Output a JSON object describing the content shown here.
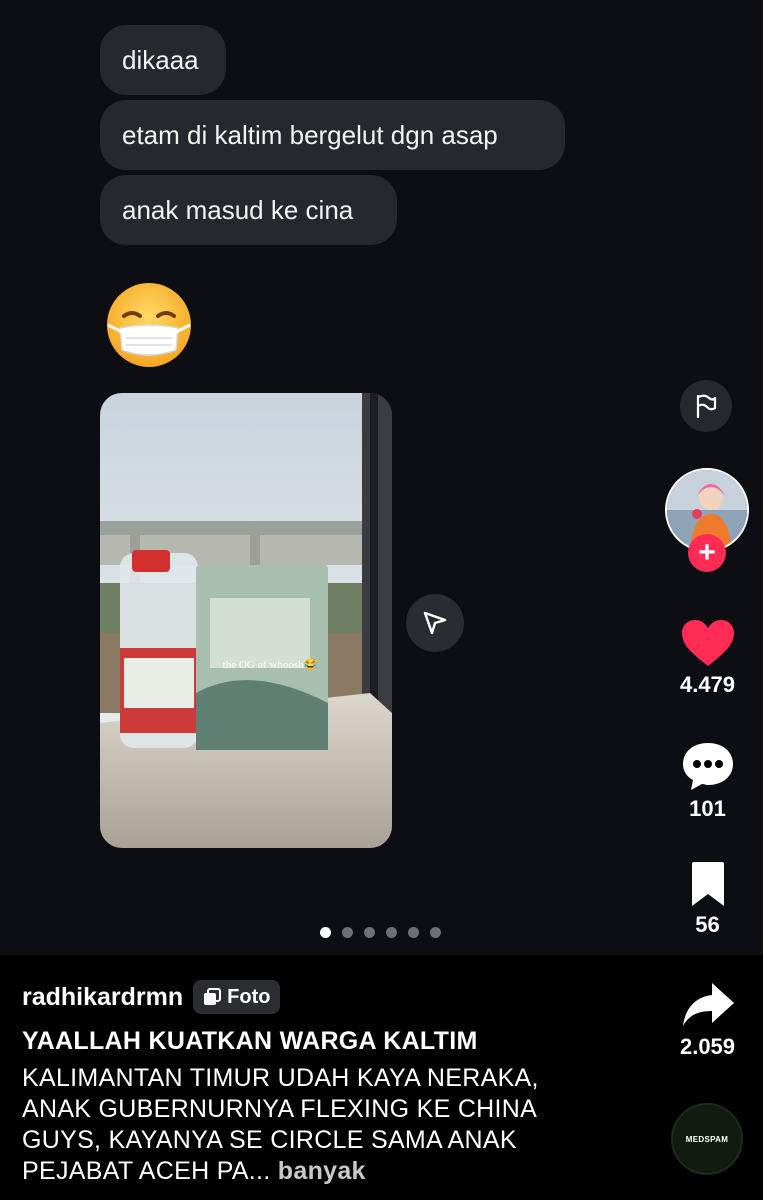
{
  "chat": {
    "messages": [
      "dikaaa",
      "etam di kaltim bergelut dgn asap",
      "anak masud ke cina"
    ],
    "emoji": "face-with-medical-mask",
    "photo_overlay_text": "the OG of whoosh😂"
  },
  "carousel": {
    "total": 6,
    "active_index": 0
  },
  "sidebar": {
    "likes": "4.479",
    "comments": "101",
    "saves": "56",
    "shares": "2.059"
  },
  "caption": {
    "username": "radhikardrmn",
    "badge": "Foto",
    "title": "YAALLAH KUATKAN WARGA KALTIM",
    "description": "KALIMANTAN TIMUR UDAH KAYA NERAKA, ANAK GUBERNURNYA FLEXING KE CHINA GUYS, KAYANYA SE CIRCLE SAMA ANAK PEJABAT ACEH PA...",
    "more": "banyak"
  },
  "music": {
    "label": "MEDSPAM"
  },
  "colors": {
    "like": "#fe2c55",
    "bubble": "#26282d",
    "background": "#0c0e13"
  }
}
